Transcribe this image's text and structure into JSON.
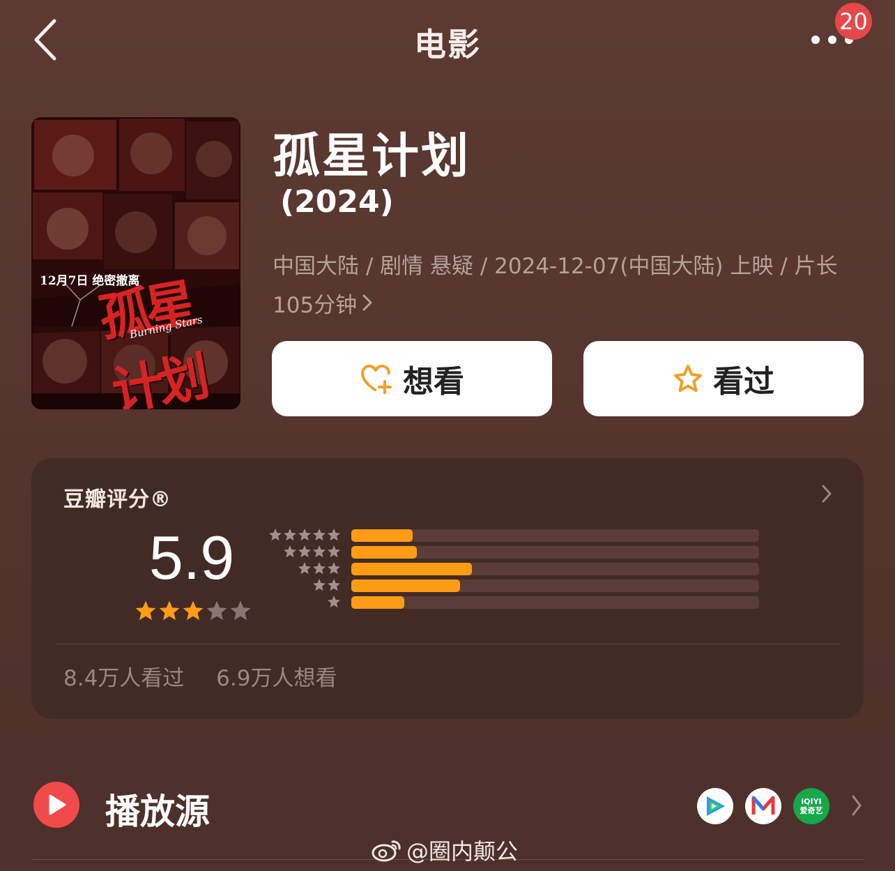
{
  "header": {
    "title": "电影",
    "notification_count": "20"
  },
  "poster": {
    "date_text": "12月7日 绝密撤离",
    "title_art": "孤星计划",
    "english_title": "Burning Stars"
  },
  "movie": {
    "title": "孤星计划",
    "year": "(2024)",
    "meta_line": "中国大陆 / 剧情 悬疑 / 2024-12-07(中国大陆) 上映 / 片长105分钟"
  },
  "actions": {
    "want_label": "想看",
    "seen_label": "看过"
  },
  "rating": {
    "title": "豆瓣评分®",
    "score": "5.9",
    "stars_filled": 3,
    "stars_total": 5,
    "distribution": [
      {
        "stars": 5,
        "fraction": 0.15
      },
      {
        "stars": 4,
        "fraction": 0.16
      },
      {
        "stars": 3,
        "fraction": 0.295
      },
      {
        "stars": 2,
        "fraction": 0.267
      },
      {
        "stars": 1,
        "fraction": 0.13
      }
    ],
    "watched": "8.4万人看过",
    "want_to_watch": "6.9万人想看"
  },
  "play_sources": {
    "label": "播放源",
    "sources": [
      {
        "name": "tencent-video-icon"
      },
      {
        "name": "mango-tv-icon"
      },
      {
        "name": "iqiyi-icon",
        "text_top": "iQIYI",
        "text_bottom": "爱奇艺"
      }
    ]
  },
  "watermark": {
    "text": "@圈内颠公"
  },
  "colors": {
    "background": "#5c3a31",
    "card": "#432b25",
    "accent_orange": "#ff9c16",
    "play_red": "#f04a4a",
    "badge_red": "#e8474a"
  }
}
